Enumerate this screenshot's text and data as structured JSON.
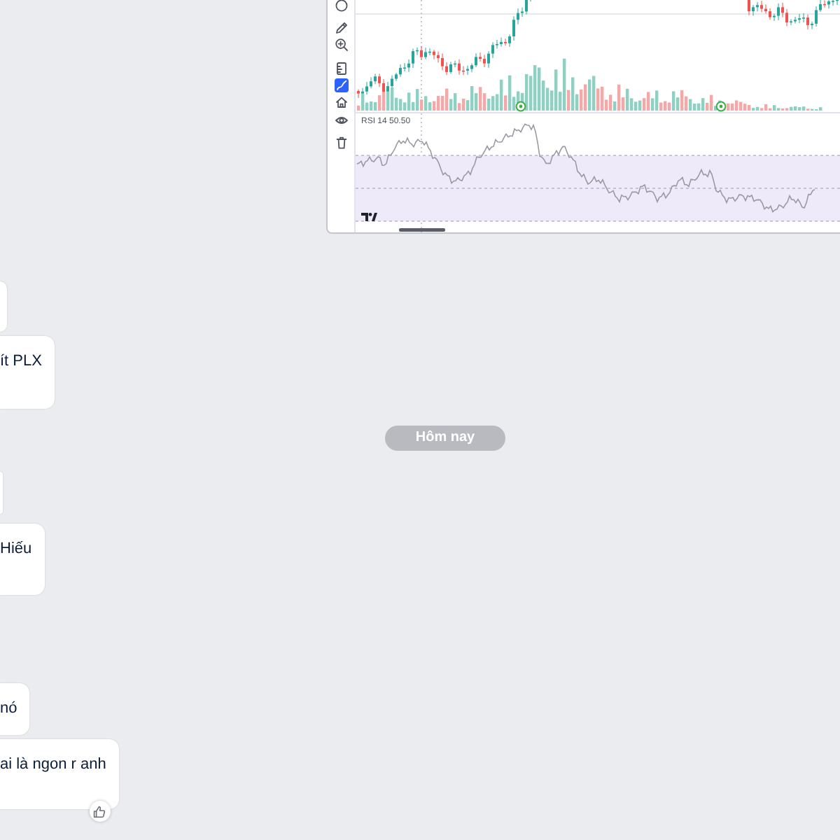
{
  "chart_screenshot": {
    "tools": [
      {
        "kind": "circle",
        "selected": false
      },
      {
        "kind": "pencil",
        "selected": false
      },
      {
        "kind": "zoom",
        "selected": false
      },
      {
        "kind": "ruler",
        "selected": false
      },
      {
        "kind": "brush",
        "selected": true
      },
      {
        "kind": "house",
        "selected": false
      },
      {
        "kind": "eye",
        "selected": false
      },
      {
        "kind": "trash",
        "selected": false
      }
    ],
    "indicator_label": "RSI 14 50.50"
  },
  "messages_before": [
    {
      "kind": "clipped",
      "reaction_button": false
    },
    {
      "kind": "text",
      "text": "ít PLX",
      "reaction_button": false
    }
  ],
  "date_divider": "Hôm nay",
  "messages_after": [
    {
      "kind": "clipped",
      "reaction_button": false
    },
    {
      "kind": "text",
      "text": "Hiếu",
      "reaction_button": false
    },
    {
      "kind": "text",
      "text": "nó",
      "reaction_button": false
    },
    {
      "kind": "text",
      "text": "ai là ngon r anh",
      "reaction_button": true
    }
  ]
}
